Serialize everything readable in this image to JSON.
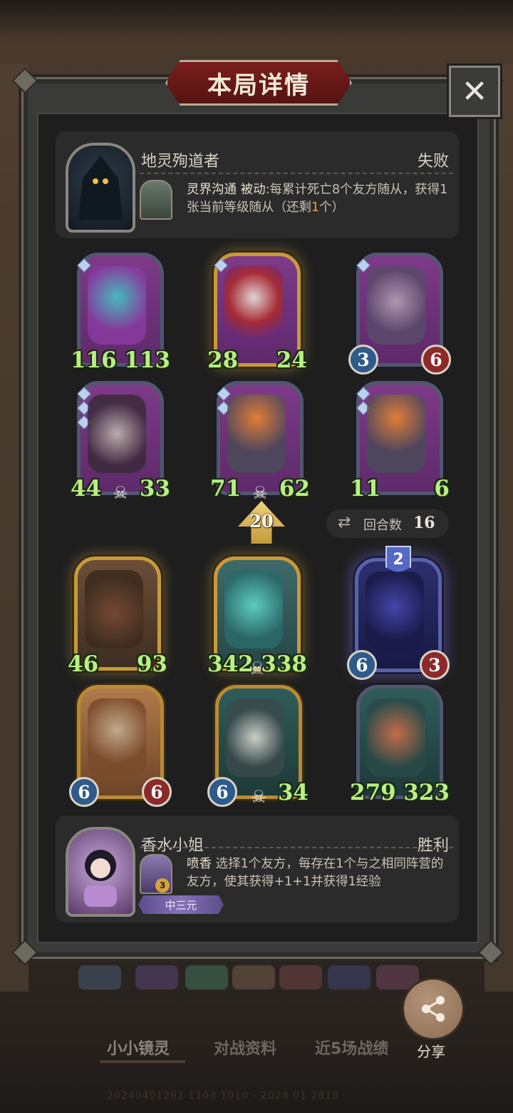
{
  "header": {
    "title": "本局详情",
    "close_icon": "close-icon"
  },
  "opponent": {
    "name": "地灵殉道者",
    "result": "失败",
    "skill_name": "灵界沟通",
    "skill_type": "被动",
    "skill_desc_a": ":每累计死亡8个友方随从，获得1张当前等级随从（还剩",
    "skill_remaining": "1",
    "skill_desc_b": "个）"
  },
  "player": {
    "name": "香水小姐",
    "result": "胜利",
    "skill_name": "喷香",
    "skill_desc": " 选择1个友方，每存在1个与之相同阵营的友方，使其获得+1+1并获得1经验",
    "hero_level": "3",
    "tag": "中三元"
  },
  "opponent_board": [
    {
      "attack": "116",
      "health": "113",
      "style": "green",
      "pips": 1,
      "skull": false
    },
    {
      "attack": "28",
      "health": "24",
      "style": "green",
      "pips": 1,
      "skull": false
    },
    {
      "attack": "3",
      "health": "6",
      "style": "ball",
      "pips": 1,
      "skull": false
    },
    {
      "attack": "44",
      "health": "33",
      "style": "green",
      "pips": 3,
      "skull": true
    },
    {
      "attack": "71",
      "health": "62",
      "style": "green",
      "pips": 2,
      "skull": true
    },
    {
      "attack": "11",
      "health": "6",
      "style": "green",
      "pips": 2,
      "skull": false
    }
  ],
  "player_board": [
    {
      "attack": "46",
      "health": "93",
      "style": "green",
      "skull": false
    },
    {
      "attack": "342",
      "health": "338",
      "style": "green",
      "skull": true
    },
    {
      "attack": "6",
      "health": "3",
      "style": "ball",
      "tier": "2",
      "skull": false
    },
    {
      "attack": "6",
      "health": "6",
      "style": "ball",
      "skull": false
    },
    {
      "attack": "6",
      "health": "34",
      "style": "mixed",
      "skull": true
    },
    {
      "attack": "279",
      "health": "323",
      "style": "green",
      "skull": false
    }
  ],
  "match": {
    "level": "20",
    "round_label": "回合数",
    "round_value": "16"
  },
  "tabs": [
    "小小镜灵",
    "对战资料",
    "近5场战绩"
  ],
  "share": {
    "label": "分享"
  },
  "footer": {
    "id_text": "20240401281 1103 1010 - 2024 01 2818"
  },
  "colors": {
    "green_stat": "#b8ef82",
    "blue_ball": "#2f5a8c",
    "red_ball": "#8c2a2a",
    "gold_frame": "#c79a3a",
    "accent_orange": "#f0a030"
  }
}
